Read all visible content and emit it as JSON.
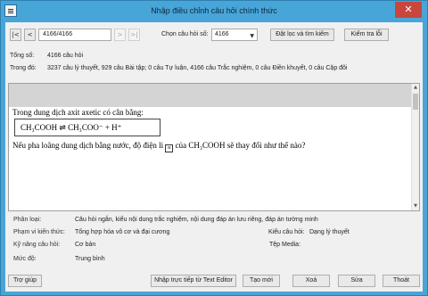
{
  "window": {
    "title": "Nhập điều chỉnh câu hỏi chính thức",
    "close_glyph": "✕"
  },
  "toolbar": {
    "first_glyph": "|<",
    "prev_glyph": "<",
    "position_value": "4166/4166",
    "next_glyph": ">",
    "last_glyph": ">|",
    "choose_label": "Chọn câu hỏi số:",
    "choose_value": "4166",
    "filter_button": "Đặt lọc và tìm kiếm",
    "check_button": "Kiểm tra lỗi"
  },
  "summary": {
    "total_label": "Tổng số:",
    "total_value": "4166 câu hỏi",
    "detail_label": "Trong đó:",
    "detail_value": "3237 câu lý thuyết, 929 câu Bài tập; 0 câu Tự luận, 4166 câu Trắc nghiệm, 0 câu Điền khuyết, 0 câu Cặp đôi"
  },
  "question": {
    "line1": "Trong dung dịch axit axetic có cân bằng:",
    "equation": "CH₃COOH ⇌ CH₃COO⁻ + H⁺",
    "line2_before": "Nếu pha loãng dung dịch bằng nước, độ điện li",
    "alpha_symbol": "α",
    "line2_after": "của CH₃COOH sẽ thay đổi như thế nào?"
  },
  "details": {
    "category_label": "Phân loại:",
    "category_value": "Câu hỏi ngắn, kiểu nội dung trắc nghiệm, nội dung đáp án lưu riêng, đáp án tường minh",
    "scope_label": "Phạm vi kiến thức:",
    "scope_value": "Tổng hợp hóa vô cơ và đại cương",
    "qtype_label": "Kiểu câu hỏi:",
    "qtype_value": "Dạng lý thuyết",
    "skill_label": "Kỹ năng câu hỏi:",
    "skill_value": "Cơ bản",
    "media_label": "Tệp Media:",
    "media_value": "",
    "level_label": "Mức độ:",
    "level_value": "Trung bình"
  },
  "footer": {
    "help": "Trợ giúp",
    "import": "Nhập trực tiếp từ Text Editor",
    "new": "Tạo mới",
    "delete": "Xoá",
    "edit": "Sửa",
    "exit": "Thoát"
  },
  "icons": {
    "app": "app-icon",
    "close": "close-icon",
    "dropdown": "chevron-down-icon",
    "scroll_up": "scroll-up-arrow-icon",
    "scroll_down": "scroll-down-arrow-icon"
  }
}
